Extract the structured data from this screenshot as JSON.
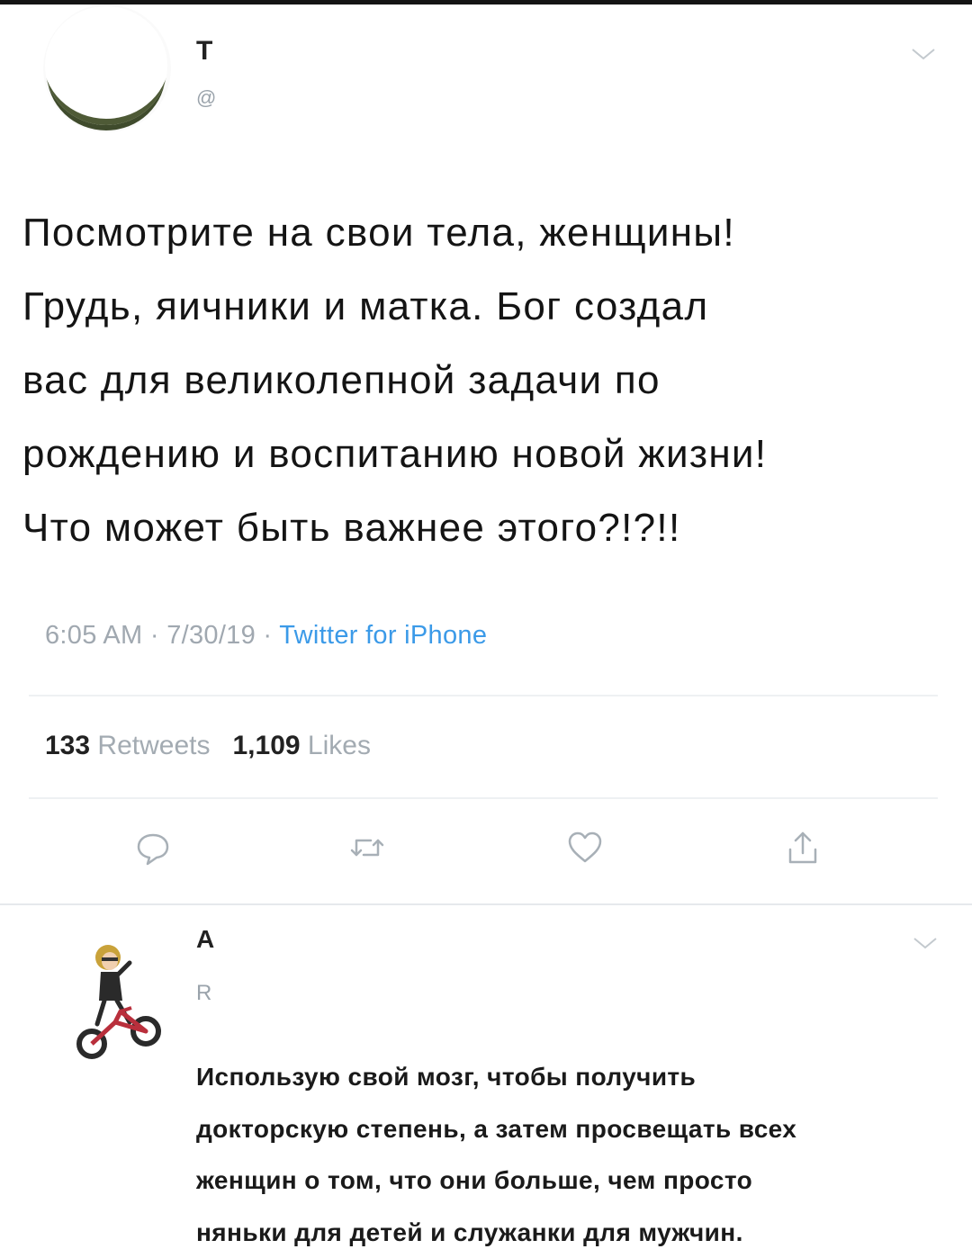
{
  "tweet": {
    "author_name": "Т",
    "author_handle": "@",
    "text_lines": [
      "Посмотрите на свои тела, женщины!",
      "Грудь, яичники и матка. Бог создал",
      "вас для великолепной задачи по",
      "рождению и воспитанию новой жизни!",
      "Что может быть важнее этого?!?!!"
    ],
    "time": "6:05 AM",
    "date": "7/30/19",
    "source": "Twitter for iPhone",
    "separator": "·",
    "retweets_count": "133",
    "retweets_label": "Retweets",
    "likes_count": "1,109",
    "likes_label": "Likes"
  },
  "icons": {
    "reply": "reply-icon",
    "retweet": "retweet-icon",
    "like": "heart-icon",
    "share": "share-icon",
    "menu": "chevron-down-icon"
  },
  "reply": {
    "author_name": "А",
    "replying_to": "R",
    "text_lines": [
      "Использую свой мозг, чтобы получить",
      "докторскую степень, а затем просвещать всех",
      "женщин о том, что они больше, чем просто",
      "няньки для детей и служанки для мужчин."
    ]
  },
  "colors": {
    "link": "#3b9ae8",
    "muted": "#a0a8b0",
    "text": "#141414"
  }
}
